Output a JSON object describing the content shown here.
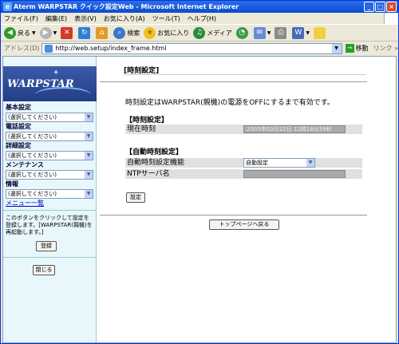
{
  "window": {
    "title": "Aterm WARPSTAR クイック設定Web - Microsoft Internet Explorer"
  },
  "menu": [
    "ファイル(F)",
    "編集(E)",
    "表示(V)",
    "お気に入り(A)",
    "ツール(T)",
    "ヘルプ(H)"
  ],
  "toolbar": {
    "back_label": "戻る",
    "search_label": "検索",
    "favorites_label": "お気に入り",
    "media_label": "メディア"
  },
  "address": {
    "label": "アドレス(D)",
    "url": "http://web.setup/index_frame.html",
    "go_label": "移動",
    "links_label": "リンク »"
  },
  "sidebar": {
    "logo_text": "WARPSTAR",
    "groups": [
      {
        "label": "基本設定",
        "selected": "(選択してください)"
      },
      {
        "label": "電話設定",
        "selected": "(選択してください)"
      },
      {
        "label": "詳細設定",
        "selected": "(選択してください)"
      },
      {
        "label": "メンテナンス",
        "selected": "(選択してください)"
      },
      {
        "label": "情報",
        "selected": "(選択してください)"
      }
    ],
    "menu_list_link": "メニュー一覧",
    "note": "このボタンをクリックして設定を登録します。[WARPSTAR(親機)を再起動します。]",
    "register_button": "登録",
    "close_button": "閉じる"
  },
  "main": {
    "page_title": "[時刻設定]",
    "description": "時刻設定はWARPSTAR(親機)の電源をOFFにするまで有効です。",
    "section_time": "【時刻設定】",
    "current_time_label": "現在時刻",
    "current_time_value": "2005年03月22日 12時18分39秒",
    "section_auto": "【自動時刻設定】",
    "auto_function_label": "自動時刻設定機能",
    "auto_function_value": "自動設定",
    "ntp_label": "NTPサーバ名",
    "ntp_value": "",
    "set_button": "設定",
    "top_page_button": "トップページへ戻る"
  },
  "colors": {
    "titlebar": "#0a4bd0",
    "sidebar_bg": "#e8f7fb",
    "logo_bg": "#233e86"
  }
}
